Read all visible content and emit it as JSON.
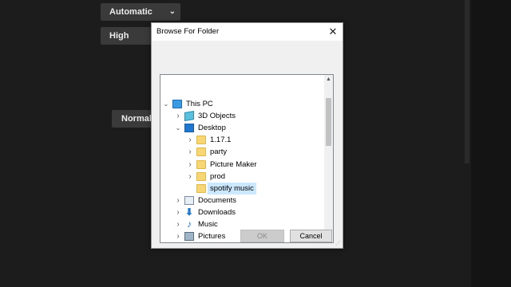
{
  "background": {
    "select_automatic": "Automatic",
    "select_high": "High",
    "button_normal": "Normal"
  },
  "dialog": {
    "title": "Browse For Folder",
    "close_glyph": "✕",
    "tree": [
      {
        "label": "This PC",
        "icon": "computer-icon",
        "expand": "down"
      },
      {
        "label": "3D Objects",
        "icon": "3d-objects-icon",
        "expand": "right"
      },
      {
        "label": "Desktop",
        "icon": "desktop-icon",
        "expand": "down"
      },
      {
        "label": "1.17.1",
        "icon": "folder-icon",
        "expand": "right"
      },
      {
        "label": "party",
        "icon": "folder-icon",
        "expand": "right"
      },
      {
        "label": "Picture Maker",
        "icon": "folder-icon",
        "expand": "right"
      },
      {
        "label": "prod",
        "icon": "folder-icon",
        "expand": "right"
      },
      {
        "label": "spotify music",
        "icon": "folder-icon",
        "expand": "none",
        "selected": true
      },
      {
        "label": "Documents",
        "icon": "documents-icon",
        "expand": "right"
      },
      {
        "label": "Downloads",
        "icon": "downloads-icon",
        "expand": "right"
      },
      {
        "label": "Music",
        "icon": "music-icon",
        "expand": "right"
      },
      {
        "label": "Pictures",
        "icon": "pictures-icon",
        "expand": "right"
      }
    ],
    "ok_label": "OK",
    "cancel_label": "Cancel"
  },
  "colors": {
    "selection": "#cce8ff",
    "folder": "#f7d775",
    "accent": "#1f77d0"
  }
}
